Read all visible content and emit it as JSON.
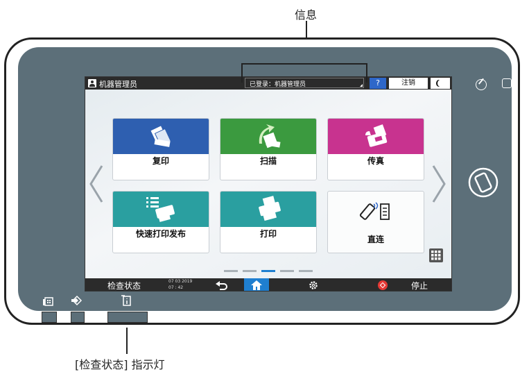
{
  "callouts": {
    "top": "信息",
    "bottom": "[检查状态] 指示灯"
  },
  "screen": {
    "user_label": "机器管理员",
    "login_status": "已登录：机器管理员",
    "help_label": "?",
    "logout_label": "注销",
    "tiles": [
      {
        "label": "复印",
        "color": "#2e5fb0"
      },
      {
        "label": "扫描",
        "color": "#3b9a3f"
      },
      {
        "label": "传真",
        "color": "#c8338f"
      },
      {
        "label": "快速打印发布",
        "color": "#2a9fa0"
      },
      {
        "label": "打印",
        "color": "#2a9fa0"
      },
      {
        "label": "直连",
        "color": "#ffffff"
      }
    ],
    "status_label": "检查状态",
    "date": "07 03 2019",
    "time": "07 : 42",
    "stop_label": "停止",
    "page_count": 5,
    "active_page_index": 2
  },
  "colors": {
    "device_body": "#5c6f79",
    "bar": "#2b2b2b",
    "help_blue": "#2e67c9",
    "active_dot": "#1f7fd0",
    "stop_red": "#e53935"
  }
}
